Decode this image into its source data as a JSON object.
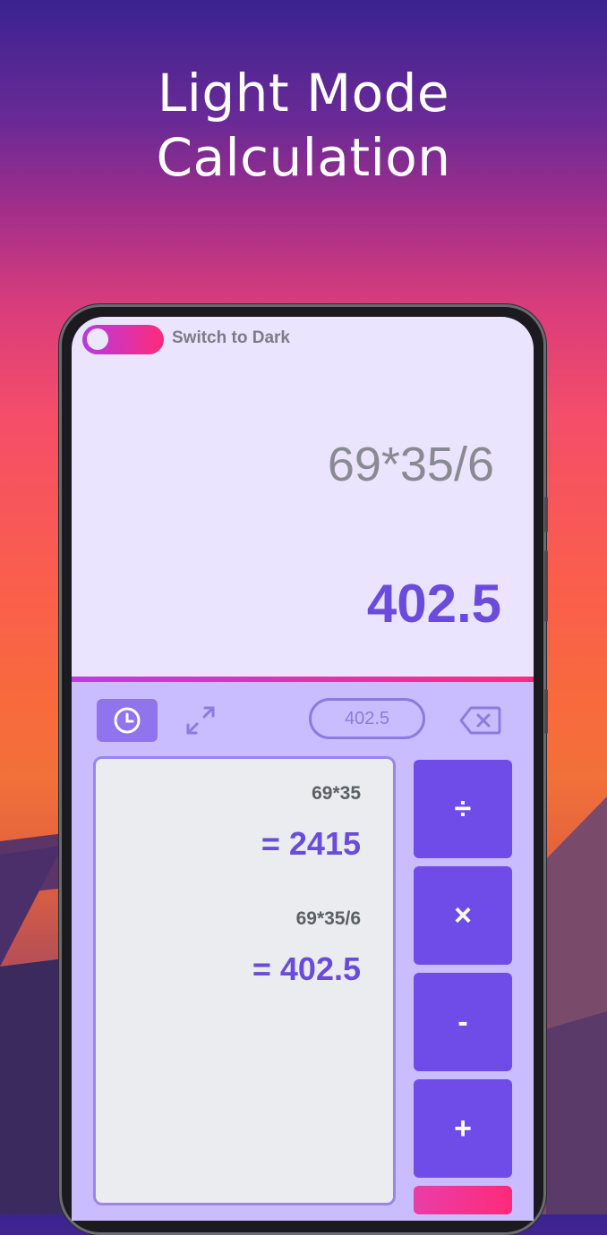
{
  "headline": {
    "line1": "Light Mode",
    "line2": "Calculation"
  },
  "toggle": {
    "label": "Switch to Dark"
  },
  "display": {
    "expression": "69*35/6",
    "result": "402.5"
  },
  "toolbar": {
    "history_icon": "clock-icon",
    "expand_icon": "expand-icon",
    "memory_value": "402.5",
    "backspace_icon": "backspace-icon"
  },
  "history": [
    {
      "expression": "69*35",
      "result": "= 2415"
    },
    {
      "expression": "69*35/6",
      "result": "= 402.5"
    }
  ],
  "operators": [
    {
      "symbol": "÷",
      "name": "divide"
    },
    {
      "symbol": "×",
      "name": "multiply"
    },
    {
      "symbol": "-",
      "name": "subtract"
    },
    {
      "symbol": "+",
      "name": "add"
    }
  ],
  "colors": {
    "accent": "#6f4ce8",
    "result_text": "#6a4bdc",
    "pad_background": "#cabdff",
    "screen_background": "#ebe4ff"
  }
}
